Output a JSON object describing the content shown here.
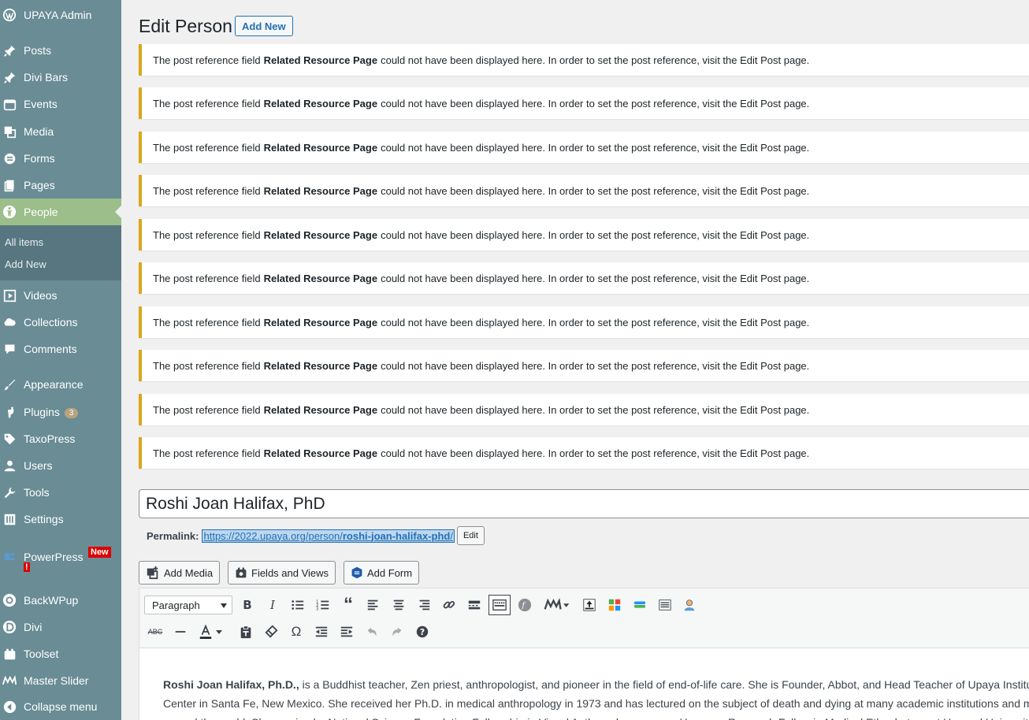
{
  "sidebar": {
    "site_title": "UPAYA Admin",
    "items": [
      {
        "label": "Posts",
        "icon": "pin-icon"
      },
      {
        "label": "Divi Bars",
        "icon": "pin-icon"
      },
      {
        "label": "Events",
        "icon": "calendar-icon"
      },
      {
        "label": "Media",
        "icon": "media-icon"
      },
      {
        "label": "Forms",
        "icon": "forms-icon"
      },
      {
        "label": "Pages",
        "icon": "pages-icon"
      },
      {
        "label": "People",
        "icon": "people-icon",
        "active": true
      },
      {
        "label": "Videos",
        "icon": "video-icon"
      },
      {
        "label": "Collections",
        "icon": "cloud-icon"
      },
      {
        "label": "Comments",
        "icon": "comment-icon"
      },
      {
        "label": "Appearance",
        "icon": "brush-icon"
      },
      {
        "label": "Plugins",
        "icon": "plugin-icon",
        "badge": "3"
      },
      {
        "label": "TaxoPress",
        "icon": "tag-icon"
      },
      {
        "label": "Users",
        "icon": "user-icon"
      },
      {
        "label": "Tools",
        "icon": "wrench-icon"
      },
      {
        "label": "Settings",
        "icon": "settings-icon"
      },
      {
        "label": "PowerPress",
        "icon": "podcast-icon",
        "badge": "New",
        "badge2": "!"
      },
      {
        "label": "BackWPup",
        "icon": "backup-icon"
      },
      {
        "label": "Divi",
        "icon": "divi-icon"
      },
      {
        "label": "Toolset",
        "icon": "toolset-icon"
      },
      {
        "label": "Master Slider",
        "icon": "slider-icon"
      },
      {
        "label": "Collapse menu",
        "icon": "collapse-icon"
      }
    ],
    "submenu": [
      "All items",
      "Add New"
    ]
  },
  "header": {
    "title": "Edit Person",
    "add_new": "Add New"
  },
  "notices": {
    "pre": "The post reference field",
    "field": "Related Resource Page",
    "post": "could not have been displayed here. In order to set the post reference, visit the Edit Post page.",
    "count": 10
  },
  "post": {
    "title": "Roshi Joan Halifax, PhD",
    "permalink_label": "Permalink:",
    "permalink_base": "https://2022.upaya.org/person/",
    "permalink_slug": "roshi-joan-halifax-phd",
    "permalink_end": "/",
    "edit_label": "Edit"
  },
  "media_buttons": {
    "add_media": "Add Media",
    "fields_views": "Fields and Views",
    "add_form": "Add Form"
  },
  "editor": {
    "format": "Paragraph",
    "content_bold": "Roshi Joan Halifax, Ph.D.,",
    "line1": " is a Buddhist teacher, Zen priest, anthropologist, and pioneer in the field of end-of-life care. She is Founder, Abbot, and Head Teacher of Upaya Institu",
    "line2": "Center in Santa Fe, New Mexico. She received her Ph.D. in medical anthropology in 1973 and has lectured on the subject of death and dying at many academic institutions and m",
    "line3": "around the world. She received a National Science Foundation Fellowship in Visual Anthropology, was an Honorary Research Fellow in Medical Ethnobotany at Harvard Universit"
  }
}
